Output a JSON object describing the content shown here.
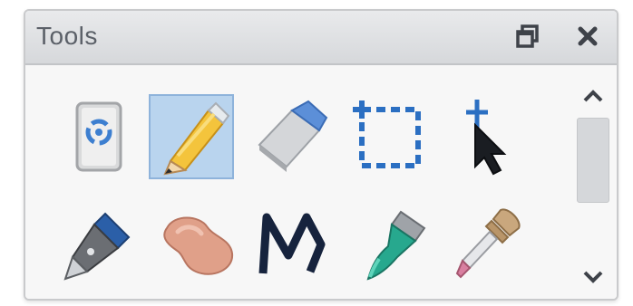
{
  "window": {
    "title": "Tools",
    "restore_icon": "restore-window-icon",
    "close_icon": "close-icon"
  },
  "tools": [
    {
      "name": "recycle-bin-tool",
      "icon": "recycle-bin-icon",
      "selected": false
    },
    {
      "name": "pencil-tool",
      "icon": "pencil-icon",
      "selected": true
    },
    {
      "name": "eraser-tool",
      "icon": "eraser-icon",
      "selected": false
    },
    {
      "name": "rectangle-select-tool",
      "icon": "rectangle-select-icon",
      "selected": false
    },
    {
      "name": "arrow-pointer-tool",
      "icon": "arrow-cursor-icon",
      "selected": false
    },
    {
      "name": "pen-nib-tool",
      "icon": "pen-nib-icon",
      "selected": false
    },
    {
      "name": "smudge-tool",
      "icon": "smudge-icon",
      "selected": false
    },
    {
      "name": "magic-wand-tool",
      "icon": "m-path-icon",
      "selected": false
    },
    {
      "name": "paint-brush-tool",
      "icon": "paint-brush-icon",
      "selected": false
    },
    {
      "name": "eyedropper-tool",
      "icon": "eyedropper-icon",
      "selected": false
    }
  ],
  "scrollbar": {
    "up_icon": "chevron-up-icon",
    "down_icon": "chevron-down-icon",
    "position": 0
  },
  "colors": {
    "selection": "#b9d4ee",
    "selection_border": "#8eb3db",
    "titlebar": "#dcdde0",
    "accent_blue": "#2b6fc2"
  }
}
